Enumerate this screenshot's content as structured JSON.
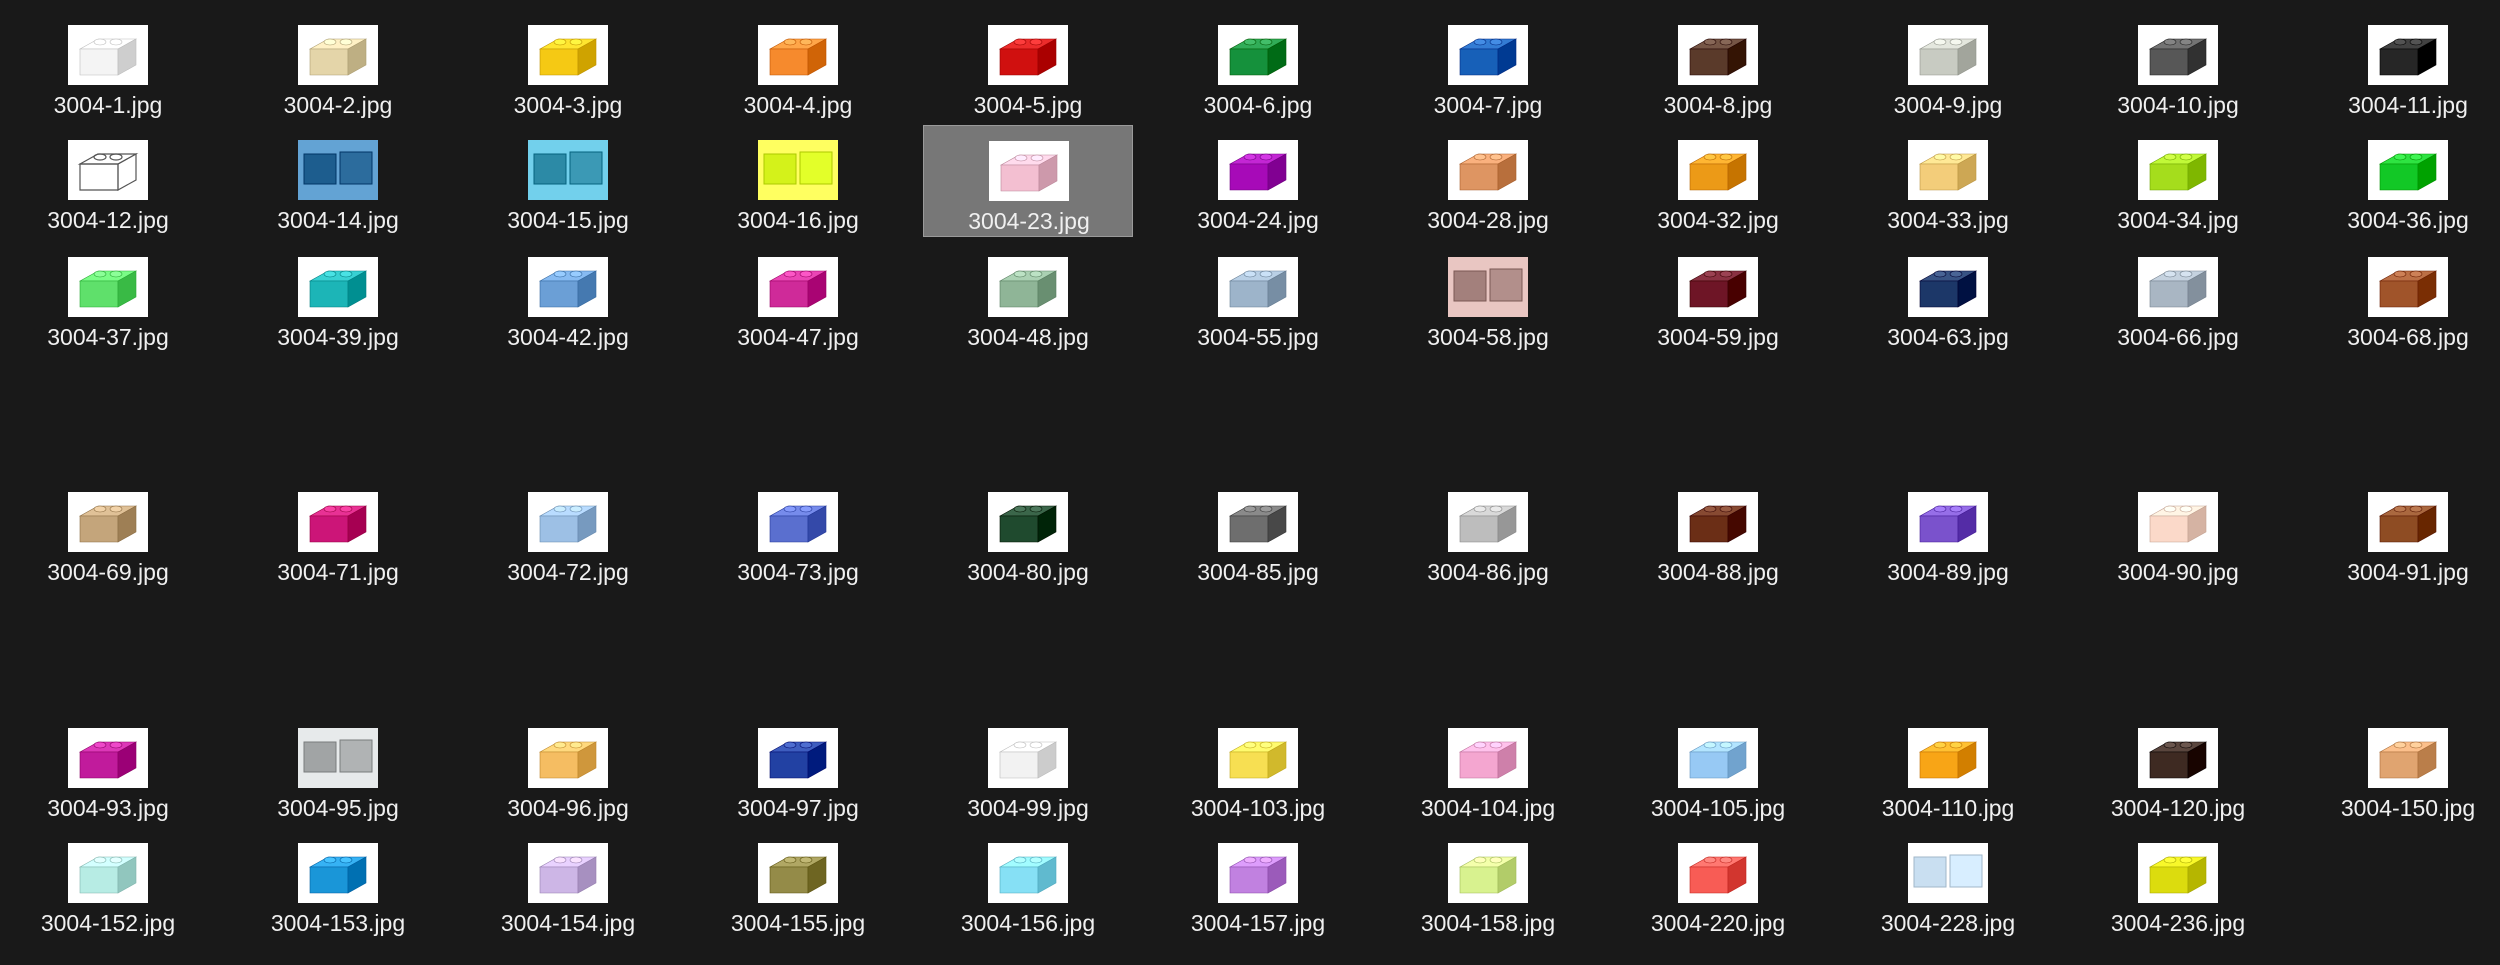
{
  "window": {
    "view": "Large icons"
  },
  "files": [
    {
      "name": "3004-1.jpg",
      "color": "#f4f4f4",
      "style": "brick"
    },
    {
      "name": "3004-2.jpg",
      "color": "#e4d5a9",
      "style": "brick"
    },
    {
      "name": "3004-3.jpg",
      "color": "#f5c914",
      "style": "brick"
    },
    {
      "name": "3004-4.jpg",
      "color": "#f68a2d",
      "style": "brick"
    },
    {
      "name": "3004-5.jpg",
      "color": "#d0100f",
      "style": "brick"
    },
    {
      "name": "3004-6.jpg",
      "color": "#15913c",
      "style": "brick"
    },
    {
      "name": "3004-7.jpg",
      "color": "#1760b8",
      "style": "brick"
    },
    {
      "name": "3004-8.jpg",
      "color": "#5a3a2a",
      "style": "brick"
    },
    {
      "name": "3004-9.jpg",
      "color": "#c8cbc2",
      "style": "brick"
    },
    {
      "name": "3004-10.jpg",
      "color": "#575757",
      "style": "brick"
    },
    {
      "name": "3004-11.jpg",
      "color": "#262626",
      "style": "brick"
    },
    {
      "name": "3004-12.jpg",
      "color": "#f8f8f8",
      "style": "outline"
    },
    {
      "name": "3004-14.jpg",
      "color": "#1d5d8e",
      "style": "photo"
    },
    {
      "name": "3004-15.jpg",
      "color": "#2c8aa6",
      "style": "photo"
    },
    {
      "name": "3004-16.jpg",
      "color": "#d4f21a",
      "style": "photo"
    },
    {
      "name": "3004-23.jpg",
      "color": "#f3bfd1",
      "style": "brick",
      "selected": true
    },
    {
      "name": "3004-24.jpg",
      "color": "#a70ab8",
      "style": "brick"
    },
    {
      "name": "3004-28.jpg",
      "color": "#de9562",
      "style": "brick"
    },
    {
      "name": "3004-32.jpg",
      "color": "#ec9a17",
      "style": "brick"
    },
    {
      "name": "3004-33.jpg",
      "color": "#f3cd7a",
      "style": "brick"
    },
    {
      "name": "3004-34.jpg",
      "color": "#a5dd1c",
      "style": "brick"
    },
    {
      "name": "3004-36.jpg",
      "color": "#12c826",
      "style": "brick"
    },
    {
      "name": "3004-37.jpg",
      "color": "#5fe06b",
      "style": "brick"
    },
    {
      "name": "3004-39.jpg",
      "color": "#1cb5b7",
      "style": "brick"
    },
    {
      "name": "3004-42.jpg",
      "color": "#6b9fd6",
      "style": "brick"
    },
    {
      "name": "3004-47.jpg",
      "color": "#cf2a99",
      "style": "brick"
    },
    {
      "name": "3004-48.jpg",
      "color": "#8fb597",
      "style": "brick"
    },
    {
      "name": "3004-55.jpg",
      "color": "#9db4ca",
      "style": "brick"
    },
    {
      "name": "3004-58.jpg",
      "color": "#a3807c",
      "style": "photo"
    },
    {
      "name": "3004-59.jpg",
      "color": "#6e1526",
      "style": "brick"
    },
    {
      "name": "3004-63.jpg",
      "color": "#1c3768",
      "style": "brick"
    },
    {
      "name": "3004-66.jpg",
      "color": "#a9b6c3",
      "style": "brick"
    },
    {
      "name": "3004-68.jpg",
      "color": "#a0542a",
      "style": "brick"
    },
    {
      "name": "3004-69.jpg",
      "color": "#c4a57b",
      "style": "brick"
    },
    {
      "name": "3004-71.jpg",
      "color": "#cc1578",
      "style": "brick"
    },
    {
      "name": "3004-72.jpg",
      "color": "#9dc0e5",
      "style": "brick"
    },
    {
      "name": "3004-73.jpg",
      "color": "#5a6fcf",
      "style": "brick"
    },
    {
      "name": "3004-80.jpg",
      "color": "#1f4a2e",
      "style": "brick"
    },
    {
      "name": "3004-85.jpg",
      "color": "#6e6e6e",
      "style": "brick"
    },
    {
      "name": "3004-86.jpg",
      "color": "#bdbdbd",
      "style": "brick"
    },
    {
      "name": "3004-88.jpg",
      "color": "#6b2e16",
      "style": "brick"
    },
    {
      "name": "3004-89.jpg",
      "color": "#7a52cc",
      "style": "brick"
    },
    {
      "name": "3004-90.jpg",
      "color": "#fbd9c9",
      "style": "brick"
    },
    {
      "name": "3004-91.jpg",
      "color": "#8e4c23",
      "style": "brick"
    },
    {
      "name": "3004-93.jpg",
      "color": "#c11b9c",
      "style": "brick"
    },
    {
      "name": "3004-95.jpg",
      "color": "#a1a4a5",
      "style": "photo"
    },
    {
      "name": "3004-96.jpg",
      "color": "#f5bd62",
      "style": "brick"
    },
    {
      "name": "3004-97.jpg",
      "color": "#2241a3",
      "style": "brick"
    },
    {
      "name": "3004-99.jpg",
      "color": "#f2f2f2",
      "style": "brick"
    },
    {
      "name": "3004-103.jpg",
      "color": "#f7df52",
      "style": "brick"
    },
    {
      "name": "3004-104.jpg",
      "color": "#f4a6d0",
      "style": "brick"
    },
    {
      "name": "3004-105.jpg",
      "color": "#97c9f4",
      "style": "brick"
    },
    {
      "name": "3004-110.jpg",
      "color": "#f8a516",
      "style": "brick"
    },
    {
      "name": "3004-120.jpg",
      "color": "#3e2a22",
      "style": "brick"
    },
    {
      "name": "3004-150.jpg",
      "color": "#e0a470",
      "style": "brick"
    },
    {
      "name": "3004-152.jpg",
      "color": "#b7ece4",
      "style": "brick"
    },
    {
      "name": "3004-153.jpg",
      "color": "#1a96d8",
      "style": "brick"
    },
    {
      "name": "3004-154.jpg",
      "color": "#cdb6e6",
      "style": "brick"
    },
    {
      "name": "3004-155.jpg",
      "color": "#948b48",
      "style": "brick"
    },
    {
      "name": "3004-156.jpg",
      "color": "#86e0f5",
      "style": "brick"
    },
    {
      "name": "3004-157.jpg",
      "color": "#c181e0",
      "style": "brick"
    },
    {
      "name": "3004-158.jpg",
      "color": "#d8f28f",
      "style": "brick"
    },
    {
      "name": "3004-220.jpg",
      "color": "#f85c55",
      "style": "brick"
    },
    {
      "name": "3004-228.jpg",
      "color": "#c9dff1",
      "style": "photo"
    },
    {
      "name": "3004-236.jpg",
      "color": "#dcdc0e",
      "style": "brick"
    }
  ]
}
